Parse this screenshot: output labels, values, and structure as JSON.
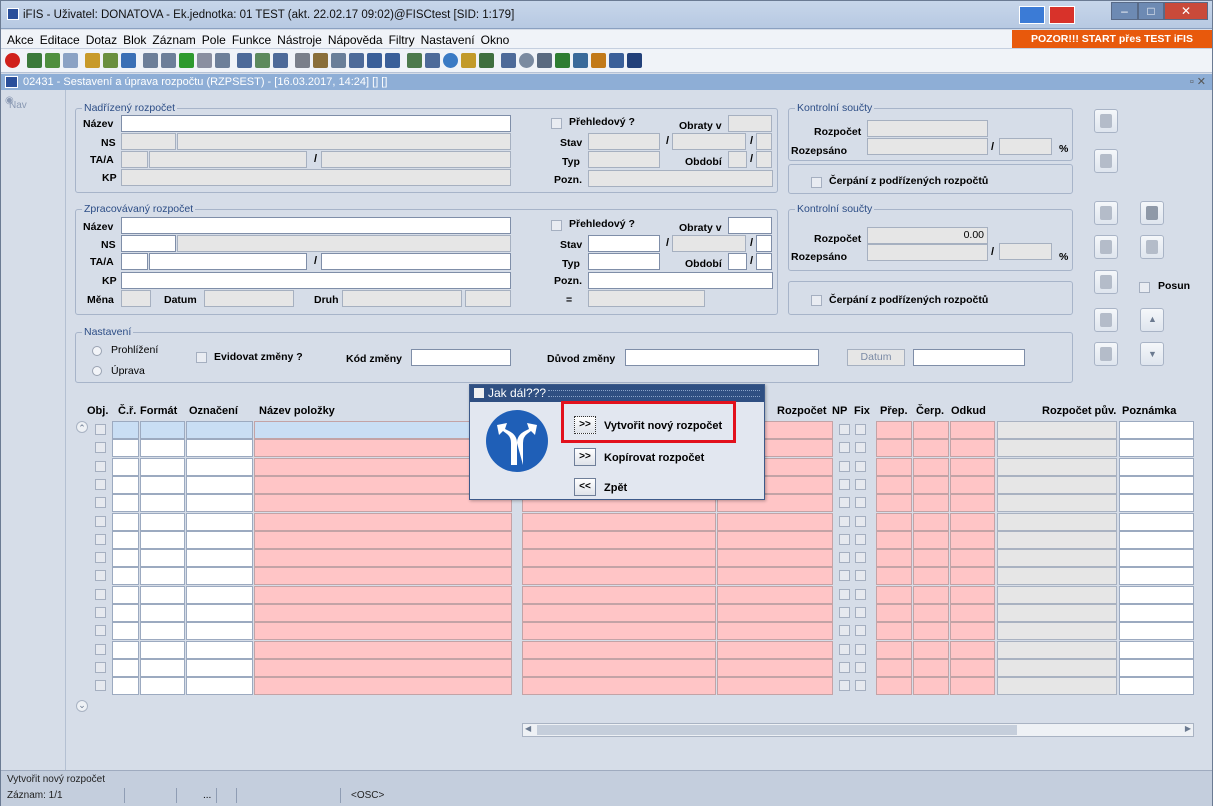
{
  "window": {
    "title": "iFIS - Uživatel: DONATOVA - Ek.jednotka: 01 TEST (akt. 22.02.17 09:02)@FISCtest  [SID: 1:179]",
    "warning": "POZOR!!! START přes TEST iFIS"
  },
  "menu": [
    "Akce",
    "Editace",
    "Dotaz",
    "Blok",
    "Záznam",
    "Pole",
    "Funkce",
    "Nástroje",
    "Nápověda",
    "Filtry",
    "Nastavení",
    "Okno"
  ],
  "form": {
    "title": "02431 - Sestavení a úprava rozpočtu (RZPSEST) - [16.03.2017, 14:24] [] []",
    "nav": "Nav"
  },
  "nadrizeny": {
    "title": "Nadřízený rozpočet",
    "nazev": "Název",
    "ns": "NS",
    "taa": "TA/A",
    "kp": "KP",
    "prehledovy": "Přehledový ?",
    "obraty": "Obraty v",
    "stav": "Stav",
    "typ": "Typ",
    "obdobi": "Období",
    "pozn": "Pozn."
  },
  "kontrolni1": {
    "title": "Kontrolní součty",
    "rozpocet": "Rozpočet",
    "rozepsano": "Rozepsáno",
    "rozpocet_value": "",
    "pct": "%",
    "cerpani": "Čerpání z podřízených rozpočtů"
  },
  "zpracovavany": {
    "title": "Zpracovávaný rozpočet",
    "nazev": "Název",
    "ns": "NS",
    "taa": "TA/A",
    "kp": "KP",
    "mena": "Měna",
    "datum": "Datum",
    "druh": "Druh",
    "prehledovy": "Přehledový ?",
    "obraty": "Obraty v",
    "stav": "Stav",
    "typ": "Typ",
    "obdobi": "Období",
    "pozn": "Pozn.",
    "eq": "="
  },
  "kontrolni2": {
    "title": "Kontrolní součty",
    "rozpocet": "Rozpočet",
    "rozepsano": "Rozepsáno",
    "rozpocet_value": "0.00",
    "pct": "%",
    "cerpani": "Čerpání z podřízených rozpočtů"
  },
  "nastaveni": {
    "title": "Nastavení",
    "prohlizeni": "Prohlížení",
    "uprava": "Úprava",
    "evidovat": "Evidovat změny ?",
    "kod": "Kód změny",
    "duvod": "Důvod změny",
    "datum": "Datum"
  },
  "side": {
    "posun": "Posun"
  },
  "grid": {
    "headers": {
      "obj": "Obj.",
      "cr": "Č.ř.",
      "format": "Formát",
      "oznaceni": "Označení",
      "nazev": "Název položky",
      "rozpocet": "Rozpočet",
      "np": "NP",
      "fix": "Fix",
      "prep": "Přep.",
      "cerp": "Čerp.",
      "odkud": "Odkud",
      "rozpocet_puv": "Rozpočet pův.",
      "poznamka": "Poznámka"
    }
  },
  "dialog": {
    "title": "Jak dál???",
    "options": [
      {
        "btn": ">>",
        "label": "Vytvořit nový rozpočet"
      },
      {
        "btn": ">>",
        "label": "Kopírovat rozpočet"
      },
      {
        "btn": "<<",
        "label": "Zpět"
      }
    ]
  },
  "status": {
    "message": "Vytvořit nový rozpočet",
    "record": "Záznam: 1/1",
    "dots": "...",
    "osc": "<OSC>"
  },
  "colors": {
    "title_bar": "#2f4f82",
    "required_field": "#ffc5c6",
    "warning": "#e8590c",
    "highlight": "#e2111c"
  }
}
